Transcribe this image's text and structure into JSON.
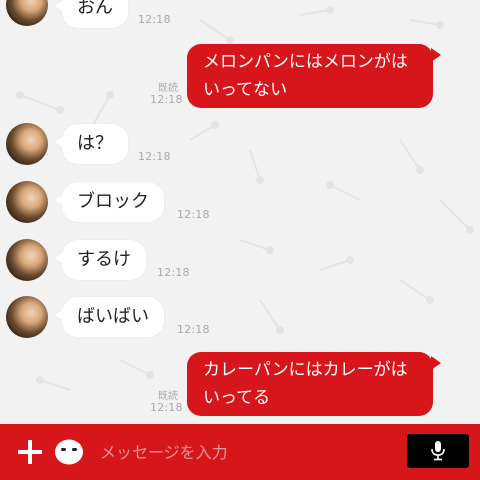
{
  "messages": [
    {
      "side": "in",
      "text": "おん",
      "time": "12:18"
    },
    {
      "side": "out",
      "text": "メロンパンにはメロンがはいってない",
      "read": "既読",
      "time": "12:18"
    },
    {
      "side": "in",
      "text": "は？",
      "time": "12:18"
    },
    {
      "side": "in",
      "text": "ブロック",
      "time": "12:18"
    },
    {
      "side": "in",
      "text": "するけ",
      "time": "12:18"
    },
    {
      "side": "in",
      "text": "ばいばい",
      "time": "12:18"
    },
    {
      "side": "out",
      "text": "カレーパンにはカレーがはいってる",
      "read": "既読",
      "time": "12:18"
    }
  ],
  "input_bar": {
    "placeholder": "メッセージを入力",
    "plus_icon": "plus-icon",
    "sticker_icon": "emoji-face-icon",
    "mic_icon": "microphone-icon"
  },
  "colors": {
    "accent": "#d7161c",
    "chat_background": "#f2f2f2",
    "incoming_bubble": "#ffffff",
    "timestamp": "#a9a9a9",
    "mic_button": "#000000"
  }
}
